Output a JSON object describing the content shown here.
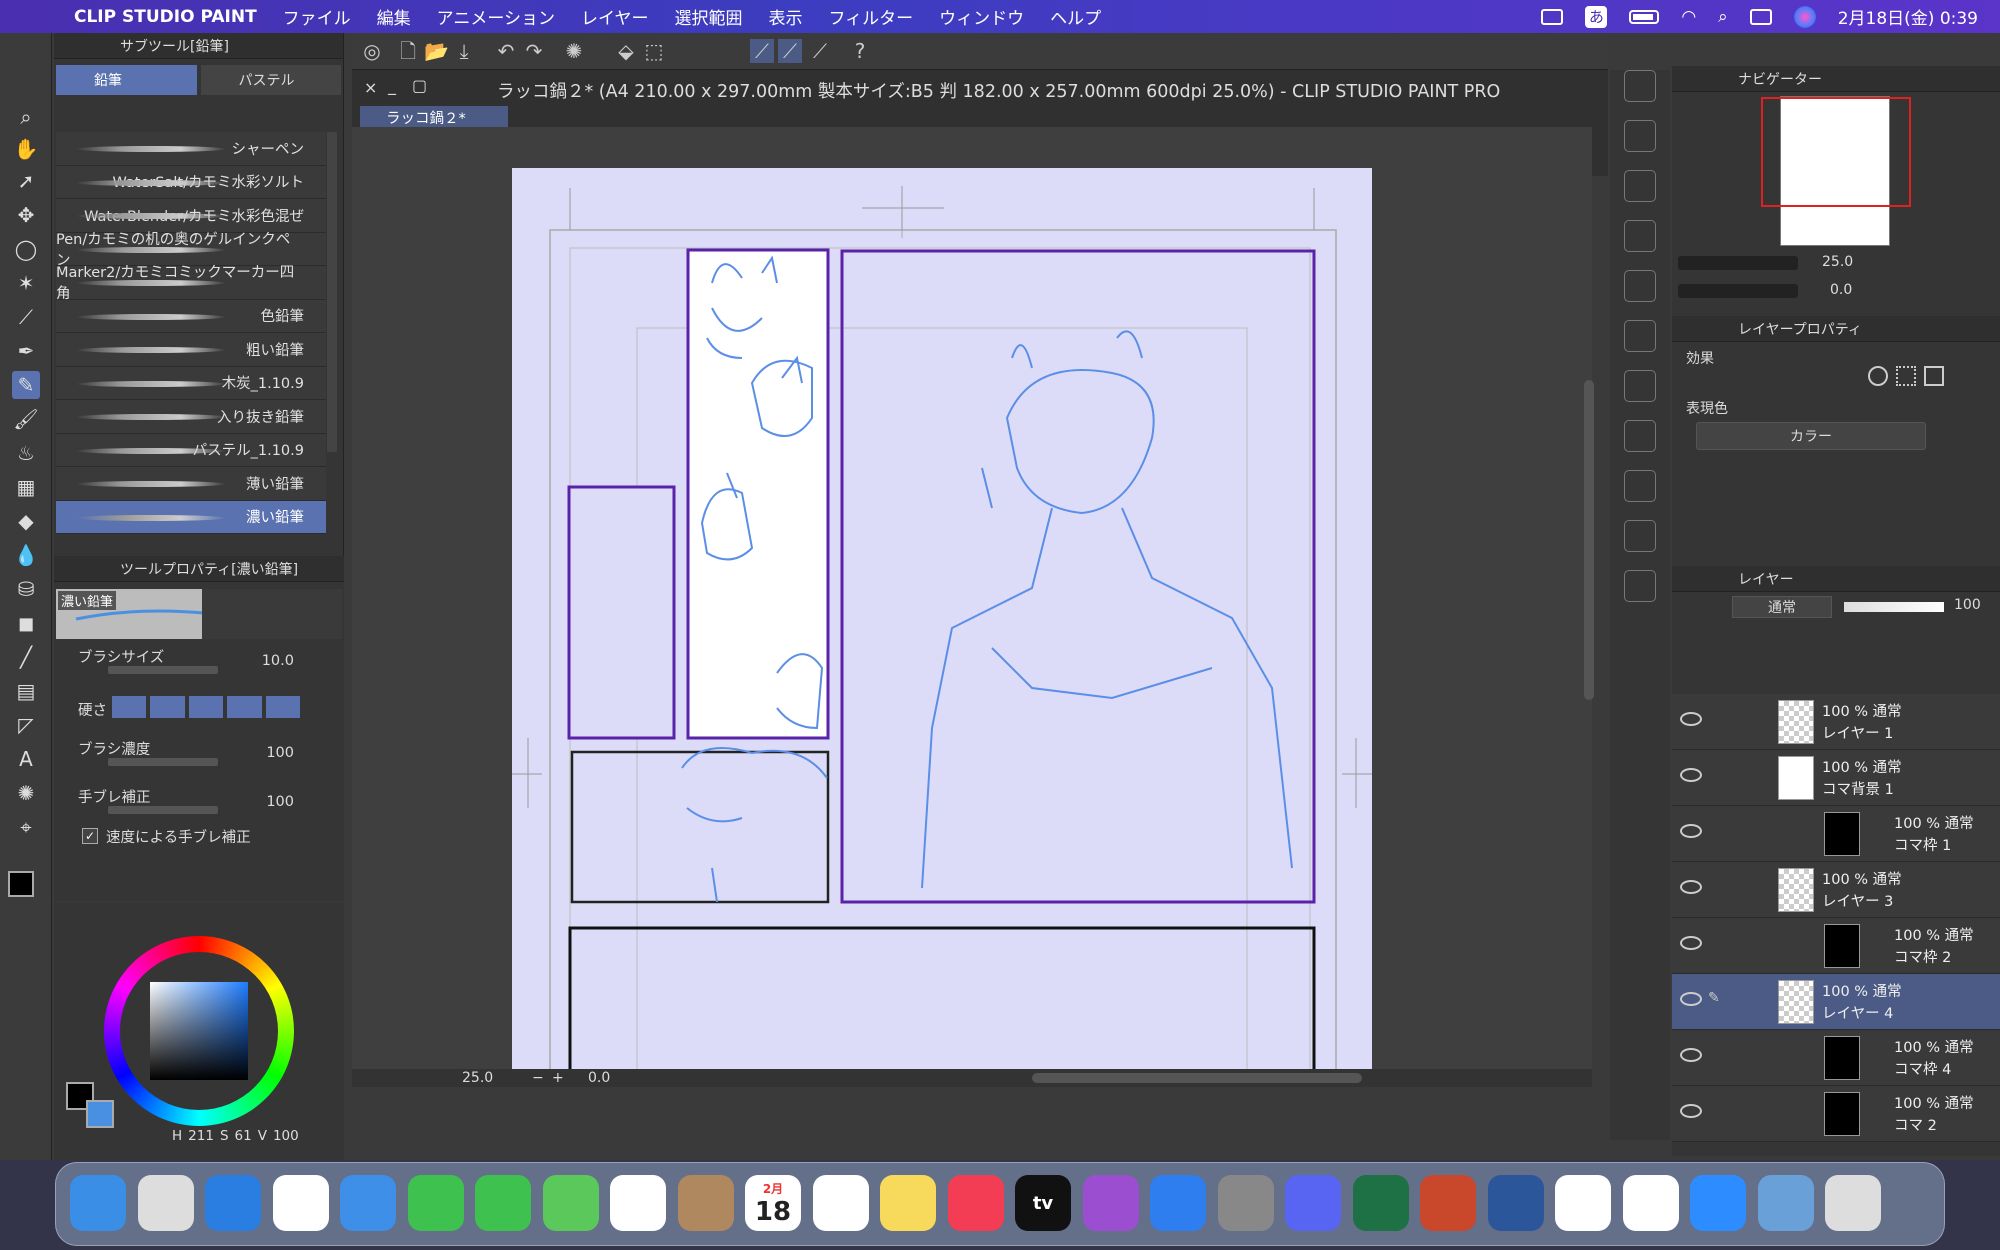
{
  "menubar": {
    "app_name": "CLIP STUDIO PAINT",
    "items": [
      "ファイル",
      "編集",
      "アニメーション",
      "レイヤー",
      "選択範囲",
      "表示",
      "フィルター",
      "ウィンドウ",
      "ヘルプ"
    ],
    "ime": "あ",
    "datetime": "2月18日(金) 0:39"
  },
  "document": {
    "title": "ラッコ鍋２* (A4 210.00 x 297.00mm 製本サイズ:B5 判 182.00 x 257.00mm 600dpi 25.0%)  - CLIP STUDIO PAINT PRO",
    "tab": "ラッコ鍋２*",
    "zoom": "25.0",
    "rotation": "0.0"
  },
  "subtool": {
    "header": "サブツール[鉛筆]",
    "tabs": [
      "鉛筆",
      "パステル"
    ],
    "brushes": [
      "シャーペン",
      "WaterSalt/カモミ水彩ソルト",
      "WaterBlender/カモミ水彩色混ぜ",
      "Pen/カモミの机の奥のゲルインクペン",
      "Marker2/カモミコミックマーカー四角",
      "色鉛筆",
      "粗い鉛筆",
      "木炭_1.10.9",
      "入り抜き鉛筆",
      "パステル_1.10.9",
      "薄い鉛筆",
      "濃い鉛筆"
    ],
    "selected": "濃い鉛筆"
  },
  "toolprop": {
    "header": "ツールプロパティ[濃い鉛筆]",
    "preview_label": "濃い鉛筆",
    "brush_size_label": "ブラシサイズ",
    "brush_size": "10.0",
    "hardness_label": "硬さ",
    "density_label": "ブラシ濃度",
    "density": "100",
    "stabilization_label": "手ブレ補正",
    "stabilization": "100",
    "speed_stab_label": "速度による手ブレ補正"
  },
  "color": {
    "h": "211",
    "s": "61",
    "v": "100",
    "main_color": "#000000",
    "sub_color": "#4a90e2",
    "hsv_labels": [
      "H",
      "S",
      "V"
    ]
  },
  "navigator": {
    "title": "ナビゲーター",
    "zoom": "25.0",
    "angle": "0.0"
  },
  "layerprop": {
    "title": "レイヤープロパティ",
    "effect_label": "効果",
    "expression_label": "表現色",
    "expression_value": "カラー"
  },
  "layers": {
    "title": "レイヤー",
    "blend_mode": "通常",
    "opacity": "100",
    "rows": [
      {
        "top": "100 % 通常",
        "name": "レイヤー 1"
      },
      {
        "top": "100 % 通常",
        "name": "コマ背景 1"
      },
      {
        "top": "100 % 通常",
        "name": "コマ枠 1"
      },
      {
        "top": "100 % 通常",
        "name": "レイヤー 3"
      },
      {
        "top": "100 % 通常",
        "name": "コマ枠 2"
      },
      {
        "top": "100 % 通常",
        "name": "レイヤー 4"
      },
      {
        "top": "100 % 通常",
        "name": "コマ枠 4"
      },
      {
        "top": "100 % 通常",
        "name": "コマ 2"
      }
    ]
  },
  "dock": {
    "calendar_month": "2月",
    "calendar_day": "18",
    "tv_label": "tv",
    "apps": [
      "Finder",
      "Launchpad",
      "Safari",
      "Chrome",
      "Mail",
      "FaceTime",
      "Messages",
      "Maps",
      "Photos",
      "Contacts",
      "Calendar",
      "Reminders",
      "Notes",
      "Music",
      "TV",
      "Podcasts",
      "App Store",
      "System Preferences",
      "Discord",
      "Excel",
      "PowerPoint",
      "Word",
      "Clip Studio",
      "Weverse",
      "Zoom",
      "Preview",
      "Trash"
    ]
  },
  "icons": [
    "apple-icon",
    "wifi-icon",
    "search-icon",
    "battery-icon",
    "eye-icon",
    "pencil-icon",
    "brush-icon",
    "trash-icon"
  ]
}
